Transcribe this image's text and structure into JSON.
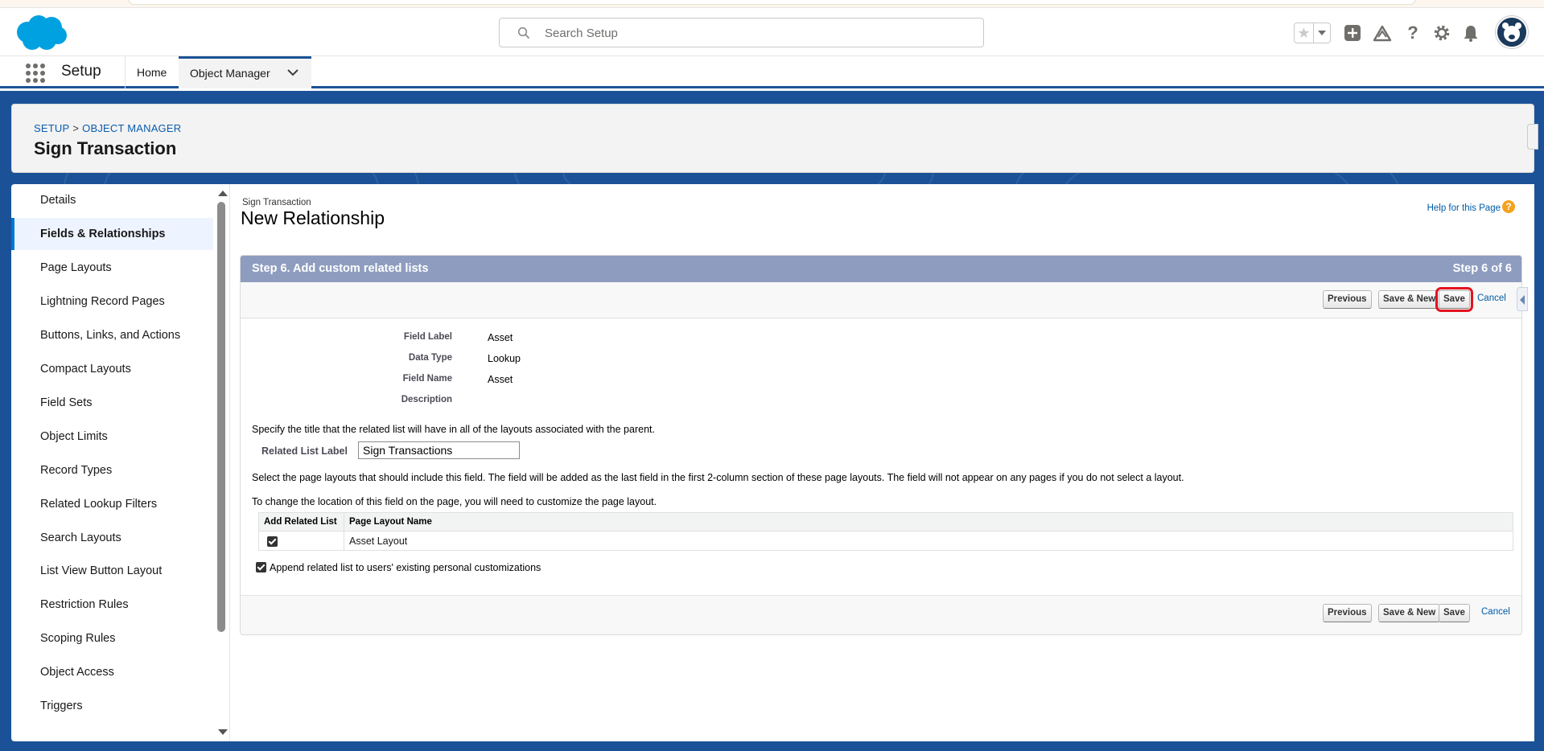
{
  "header": {
    "search_placeholder": "Search Setup",
    "icons": [
      "salesforce-cloud-logo",
      "star-icon",
      "chevron-down-icon",
      "add-icon",
      "trailhead-icon",
      "help-icon",
      "gear-icon",
      "bell-icon",
      "avatar"
    ]
  },
  "app_nav": {
    "app_name": "Setup",
    "tabs": [
      {
        "label": "Home"
      },
      {
        "label": "Object Manager"
      }
    ]
  },
  "page_header": {
    "breadcrumb": [
      "SETUP",
      "OBJECT MANAGER"
    ],
    "breadcrumb_sep": ">",
    "title": "Sign Transaction"
  },
  "sidebar": {
    "items": [
      {
        "label": "Details"
      },
      {
        "label": "Fields & Relationships",
        "active": true
      },
      {
        "label": "Page Layouts"
      },
      {
        "label": "Lightning Record Pages"
      },
      {
        "label": "Buttons, Links, and Actions"
      },
      {
        "label": "Compact Layouts"
      },
      {
        "label": "Field Sets"
      },
      {
        "label": "Object Limits"
      },
      {
        "label": "Record Types"
      },
      {
        "label": "Related Lookup Filters"
      },
      {
        "label": "Search Layouts"
      },
      {
        "label": "List View Button Layout"
      },
      {
        "label": "Restriction Rules"
      },
      {
        "label": "Scoping Rules"
      },
      {
        "label": "Object Access"
      },
      {
        "label": "Triggers"
      }
    ]
  },
  "main": {
    "object_label": "Sign Transaction",
    "title": "New Relationship",
    "help_link": "Help for this Page",
    "help_icon_glyph": "?",
    "step": {
      "title": "Step 6. Add custom related lists",
      "counter": "Step 6 of 6"
    },
    "buttons": {
      "previous": "Previous",
      "save_new": "Save & New",
      "save": "Save",
      "cancel": "Cancel"
    },
    "fields": [
      {
        "label": "Field Label",
        "value": "Asset"
      },
      {
        "label": "Data Type",
        "value": "Lookup"
      },
      {
        "label": "Field Name",
        "value": "Asset"
      },
      {
        "label": "Description",
        "value": ""
      }
    ],
    "related_list_instructions": "Specify the title that the related list will have in all of the layouts associated with the parent.",
    "related_list_label": "Related List Label",
    "related_list_value": "Sign Transactions",
    "layout_instructions": "Select the page layouts that should include this field. The field will be added as the last field in the first 2-column section of these page layouts. The field will not appear on any pages if you do not select a layout.",
    "location_instructions": "To change the location of this field on the page, you will need to customize the page layout.",
    "table": {
      "headers": [
        "Add Related List",
        "Page Layout Name"
      ],
      "rows": [
        {
          "checked": true,
          "name": "Asset Layout"
        }
      ]
    },
    "append_label": "Append related list to users' existing personal customizations",
    "append_checked": true
  }
}
